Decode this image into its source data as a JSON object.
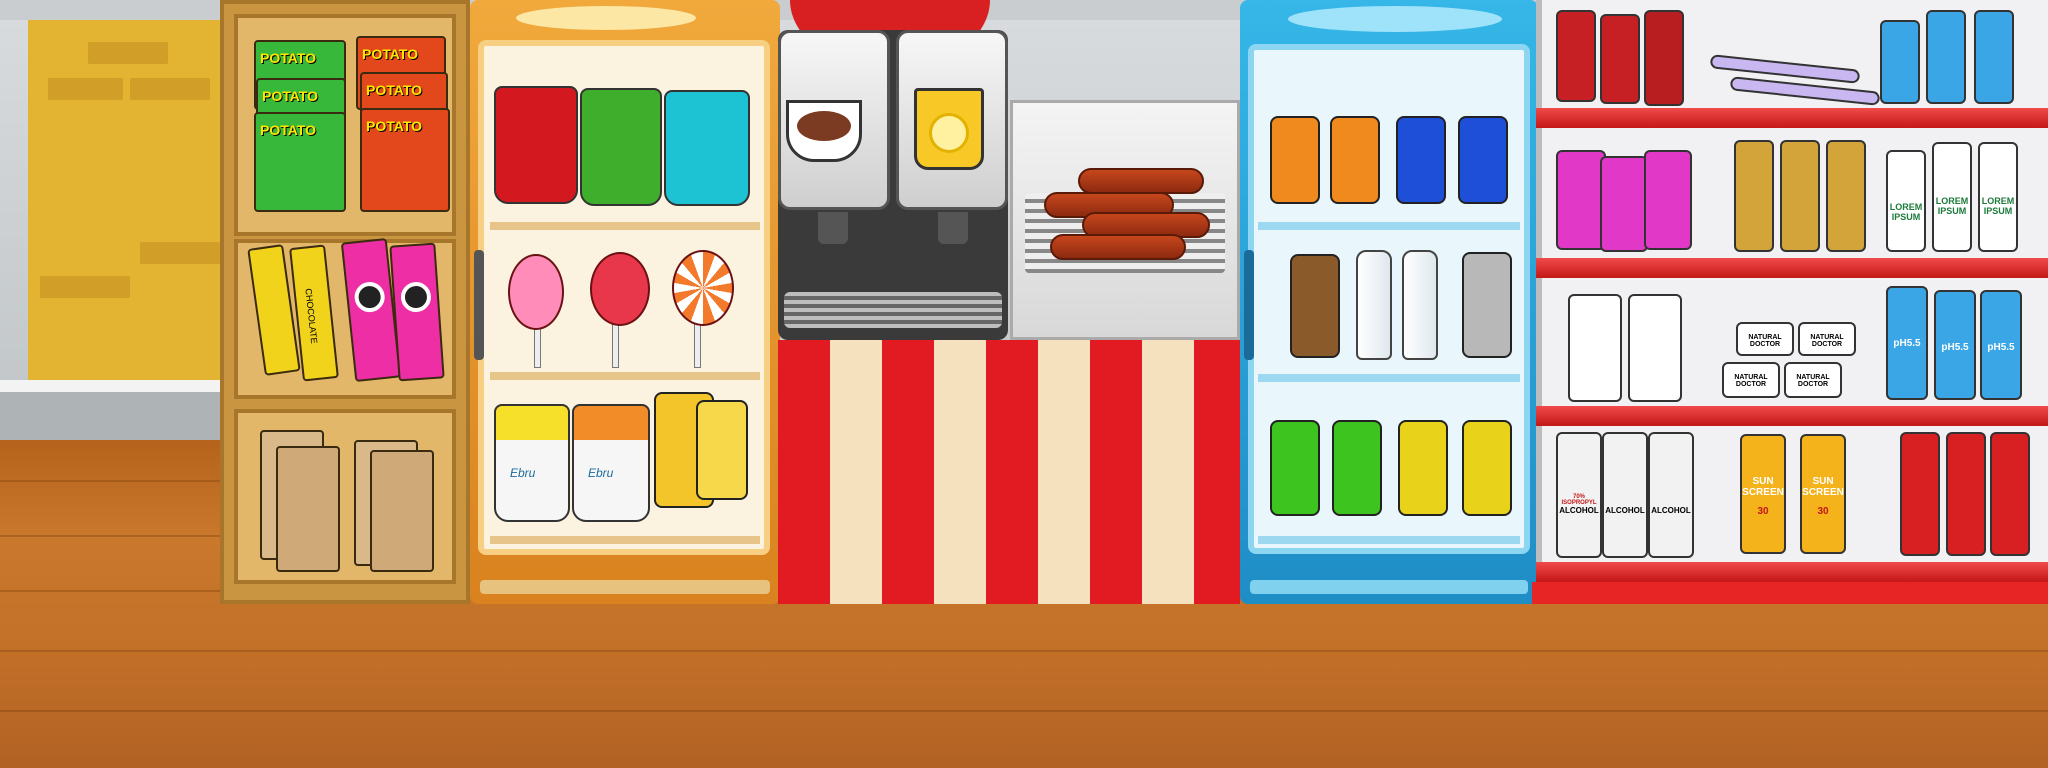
{
  "scene": {
    "title": "",
    "colors": {
      "floor": "#c9782c",
      "counter_red": "#e21b23",
      "counter_cream": "#f6e1bf",
      "fridge_orange": "#f1a93c",
      "fridge_blue": "#36b7e8",
      "rack_red": "#d81f22"
    }
  },
  "snack_shelf": {
    "chips": [
      {
        "label": "POTATO"
      },
      {
        "label": "POTATO"
      },
      {
        "label": "POTATO"
      },
      {
        "label": "POTATO"
      },
      {
        "label": "POTATO"
      },
      {
        "label": "POTATO"
      }
    ],
    "chocolate_label": "CHOCOLATE",
    "cookie_icon": "cookie-icon"
  },
  "fridge_snacks": {
    "ice_cream_icon": "ice-cream-icon",
    "lollipop_icon": "lollipop-icon",
    "yogurt_brand": "Ebru",
    "juice_icon": "pear-icon"
  },
  "dispenser": {
    "coffee_icon": "coffee-cup-icon",
    "lemonade_icon": "lemon-cup-icon",
    "hotdog_icon": "sausage-icon"
  },
  "fridge_drinks": {
    "can_colors": [
      "#f08a1e",
      "#1e4fd8",
      "#8b5a2b",
      "#b8b8b8",
      "#3ec41f",
      "#e8d21a"
    ]
  },
  "rack": {
    "lotion_label": "LOREM IPSUM",
    "ph_label": "pH5.5",
    "cream_label": "NATURAL DOCTOR",
    "sunscreen_label": "SUN SCREEN",
    "spf_label": "30",
    "alcohol_label": "ALCOHOL",
    "alcohol_sub": "70% ISOPROPYL"
  }
}
